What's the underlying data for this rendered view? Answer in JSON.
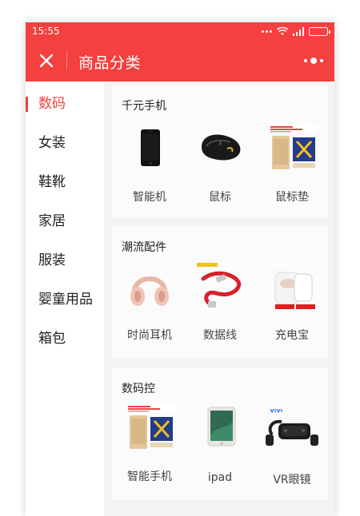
{
  "status_bar": {
    "time": "15:55"
  },
  "header": {
    "title": "商品分类"
  },
  "sidebar": {
    "items": [
      {
        "label": "数码",
        "active": true
      },
      {
        "label": "女装"
      },
      {
        "label": "鞋靴"
      },
      {
        "label": "家居"
      },
      {
        "label": "服装"
      },
      {
        "label": "婴童用品"
      },
      {
        "label": "箱包"
      }
    ]
  },
  "sections": [
    {
      "title": "千元手机",
      "products": [
        {
          "label": "智能机",
          "icon": "black-phone"
        },
        {
          "label": "鼠标",
          "icon": "gaming-mouse"
        },
        {
          "label": "鼠标垫",
          "icon": "promo-phone-box"
        }
      ]
    },
    {
      "title": "潮流配件",
      "products": [
        {
          "label": "时尚耳机",
          "icon": "rose-gold-headphones"
        },
        {
          "label": "数据线",
          "icon": "red-usb-cable"
        },
        {
          "label": "充电宝",
          "icon": "power-bank"
        }
      ]
    },
    {
      "title": "数码控",
      "products": [
        {
          "label": "智能手机",
          "icon": "promo-phone-box"
        },
        {
          "label": "ipad",
          "icon": "tablet"
        },
        {
          "label": "VR眼镜",
          "icon": "vr-headset"
        }
      ]
    }
  ],
  "colors": {
    "accent": "#f4403e",
    "sidebar_bg": "#ffffff",
    "content_bg": "#f4f4f4"
  }
}
